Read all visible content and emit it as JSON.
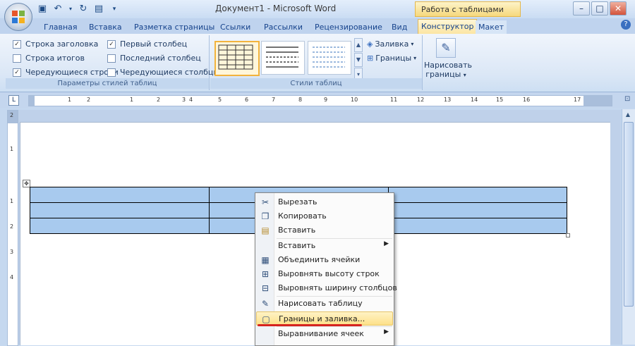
{
  "window": {
    "title": "Документ1 - Microsoft Word",
    "context_title": "Работа с таблицами",
    "buttons": [
      "–",
      "□",
      "✕"
    ]
  },
  "quick_access": [
    "save-icon",
    "undo-icon",
    "redo-icon",
    "print-preview-icon",
    "customize-icon"
  ],
  "tabs": [
    {
      "label": "Главная"
    },
    {
      "label": "Вставка"
    },
    {
      "label": "Разметка страницы"
    },
    {
      "label": "Ссылки"
    },
    {
      "label": "Рассылки"
    },
    {
      "label": "Рецензирование"
    },
    {
      "label": "Вид"
    },
    {
      "label": "Конструктор",
      "active": true
    },
    {
      "label": "Макет"
    }
  ],
  "ribbon": {
    "style_options": {
      "label": "Параметры стилей таблиц",
      "options": [
        {
          "label": "Строка заголовка",
          "checked": true
        },
        {
          "label": "Строка итогов",
          "checked": false
        },
        {
          "label": "Чередующиеся строки",
          "checked": true
        },
        {
          "label": "Первый столбец",
          "checked": true
        },
        {
          "label": "Последний столбец",
          "checked": false
        },
        {
          "label": "Чередующиеся столбцы",
          "checked": false
        }
      ]
    },
    "table_styles": {
      "label": "Стили таблиц",
      "shading": "Заливка",
      "borders": "Границы"
    },
    "draw": {
      "line1": "Нарисовать",
      "line2": "границы"
    }
  },
  "ruler": {
    "marks": [
      "1",
      "2",
      "1",
      "2",
      "3",
      "4",
      "5",
      "6",
      "7",
      "8",
      "9",
      "10",
      "11",
      "12",
      "13",
      "14",
      "15",
      "16",
      "17"
    ],
    "vmarks": [
      "2",
      "1",
      "1",
      "2",
      "3",
      "4"
    ]
  },
  "context_menu": {
    "items": [
      {
        "label": "Вырезать",
        "icon": "scissors-icon"
      },
      {
        "label": "Копировать",
        "icon": "copy-icon"
      },
      {
        "label": "Вставить",
        "icon": "paste-icon"
      },
      {
        "label": "Вставить",
        "icon": "",
        "submenu": true
      },
      {
        "label": "Объединить ячейки",
        "icon": "merge-cells-icon"
      },
      {
        "label": "Выровнять высоту строк",
        "icon": "distribute-rows-icon"
      },
      {
        "label": "Выровнять ширину столбцов",
        "icon": "distribute-columns-icon"
      },
      {
        "label": "Нарисовать таблицу",
        "icon": "draw-table-icon"
      },
      {
        "label": "Границы и заливка...",
        "icon": "borders-icon",
        "highlighted": true
      },
      {
        "label": "Выравнивание ячеек",
        "icon": "",
        "submenu": true
      }
    ]
  },
  "colors": {
    "table_fill": "#a8caee",
    "highlight": "#fde089",
    "annotation_line": "#d6231f"
  }
}
